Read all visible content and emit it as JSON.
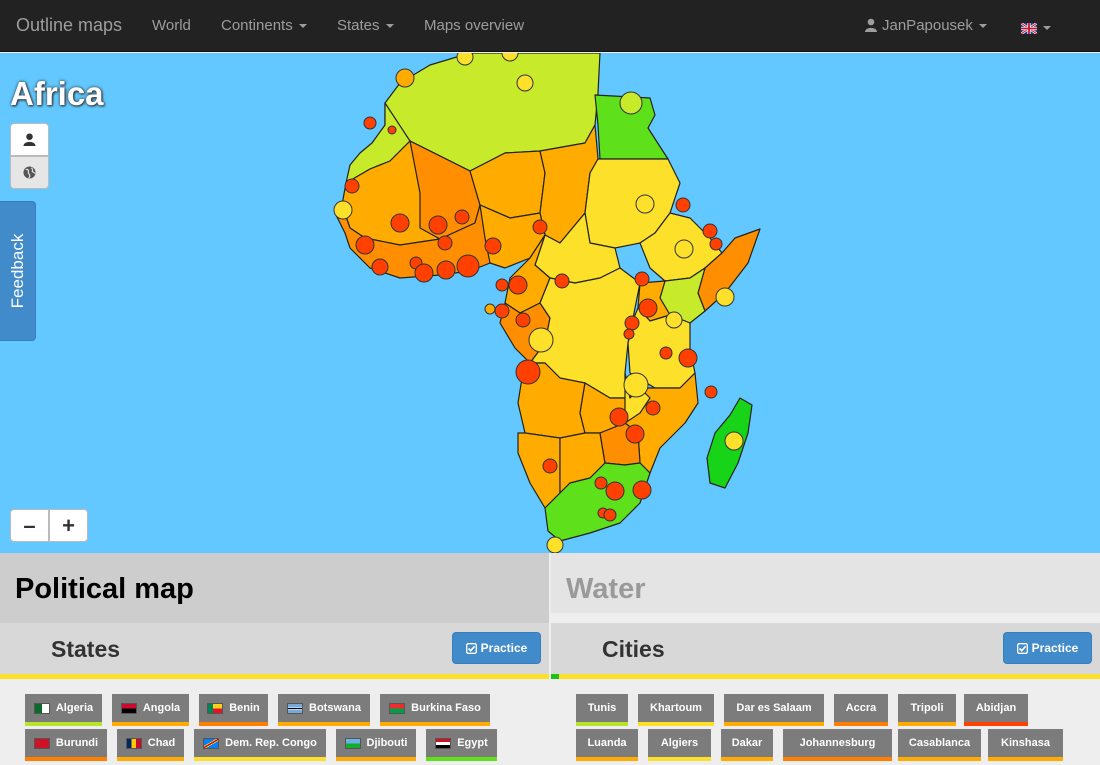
{
  "navbar": {
    "brand": "Outline maps",
    "items": [
      {
        "label": "World",
        "dropdown": false
      },
      {
        "label": "Continents",
        "dropdown": true
      },
      {
        "label": "States",
        "dropdown": true
      },
      {
        "label": "Maps overview",
        "dropdown": false
      }
    ],
    "user": "JanPapousek",
    "language_icon": "uk-flag-icon"
  },
  "map": {
    "title": "Africa",
    "tools": [
      "person-icon",
      "globe-icon"
    ],
    "zoom_out": "–",
    "zoom_in": "+",
    "feedback": "Feedback",
    "colors": {
      "water": "#62c8ff",
      "known": "#5ee01a",
      "good": "#c7ea2a",
      "medium": "#fde02a",
      "weak": "#ffab00",
      "poor": "#ff7e00",
      "bad": "#ff4000"
    }
  },
  "panels": {
    "left": {
      "title": "Political map",
      "section": "States",
      "practice": "Practice",
      "items": [
        {
          "name": "Algeria",
          "flag": "algeria-flag-icon",
          "color": "#b7e32d"
        },
        {
          "name": "Angola",
          "flag": "angola-flag-icon",
          "color": "#ffab00"
        },
        {
          "name": "Benin",
          "flag": "benin-flag-icon",
          "color": "#ff7e00"
        },
        {
          "name": "Botswana",
          "flag": "botswana-flag-icon",
          "color": "#ffab00"
        },
        {
          "name": "Burkina Faso",
          "flag": "burkina-faso-flag-icon",
          "color": "#ffab00"
        },
        {
          "name": "Burundi",
          "flag": "burundi-flag-icon",
          "color": "#ff7e00"
        },
        {
          "name": "Chad",
          "flag": "chad-flag-icon",
          "color": "#ffab00"
        },
        {
          "name": "Dem. Rep. Congo",
          "flag": "dr-congo-flag-icon",
          "color": "#fde02a"
        },
        {
          "name": "Djibouti",
          "flag": "djibouti-flag-icon",
          "color": "#ffab00"
        },
        {
          "name": "Egypt",
          "flag": "egypt-flag-icon",
          "color": "#5ee01a"
        }
      ]
    },
    "right": {
      "title": "Water",
      "section": "Cities",
      "practice": "Practice",
      "items": [
        {
          "name": "Tunis",
          "color": "#b7e32d"
        },
        {
          "name": "Khartoum",
          "color": "#fde02a"
        },
        {
          "name": "Dar es Salaam",
          "color": "#ffab00"
        },
        {
          "name": "Accra",
          "color": "#ff7e00"
        },
        {
          "name": "Tripoli",
          "color": "#ffab00"
        },
        {
          "name": "Abidjan",
          "color": "#ff4000"
        },
        {
          "name": "Luanda",
          "color": "#ffab00"
        },
        {
          "name": "Algiers",
          "color": "#fde02a"
        },
        {
          "name": "Dakar",
          "color": "#ffab00"
        },
        {
          "name": "Johannesburg",
          "color": "#ff7e00"
        },
        {
          "name": "Casablanca",
          "color": "#ffab00"
        },
        {
          "name": "Kinshasa",
          "color": "#ffab00"
        }
      ]
    }
  }
}
